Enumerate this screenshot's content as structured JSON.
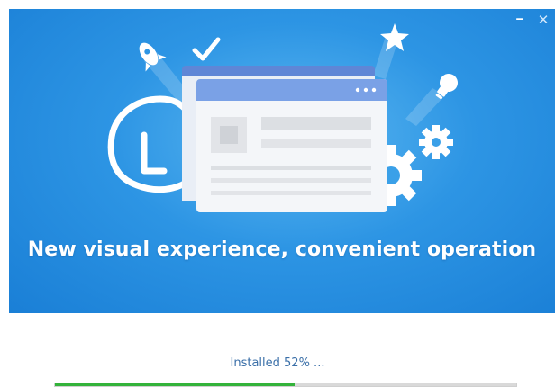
{
  "window": {
    "minimize_icon": "minimize-icon",
    "close_icon": "close-icon",
    "minimize_glyph": "‒",
    "close_glyph": "✕"
  },
  "banner": {
    "headline": "New visual experience, convenient operation",
    "background_color": "#2d95e4"
  },
  "install": {
    "status_text": "Installed 52% ...",
    "progress_fraction": 0.52,
    "progress_color": "#33b33a",
    "track_color": "#d9d9d9"
  }
}
